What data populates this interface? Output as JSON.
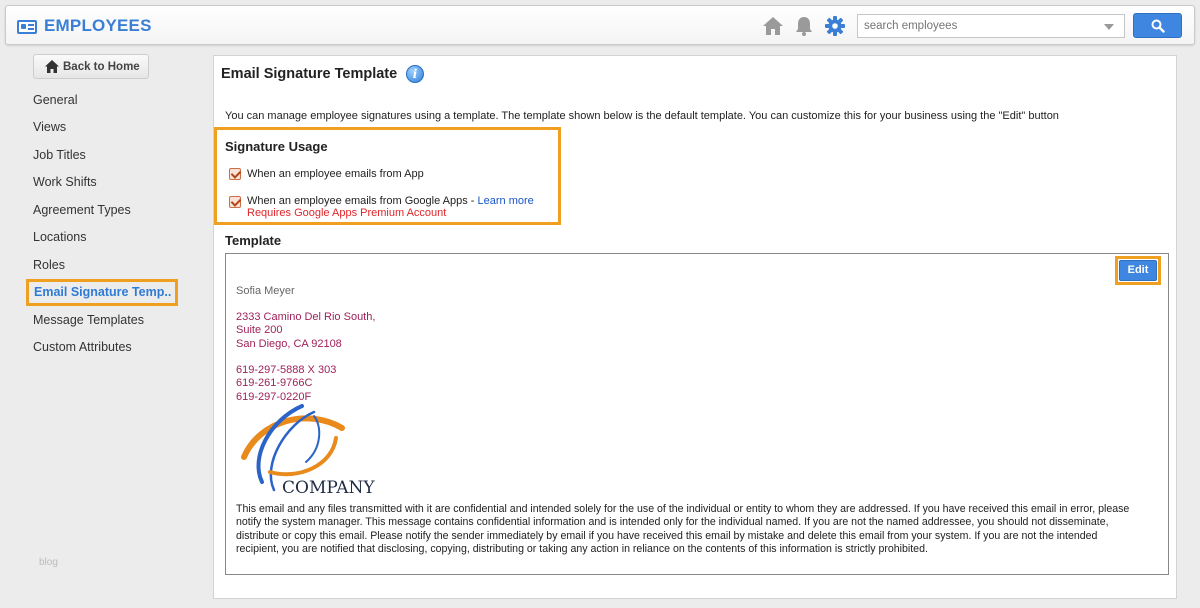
{
  "header": {
    "app_title": "EMPLOYEES",
    "search_placeholder": "search employees",
    "icons": [
      "home-icon",
      "bell-icon",
      "gear-icon",
      "search-icon"
    ],
    "accent_color": "#3a7fd5"
  },
  "sidebar": {
    "back_label": "Back to Home",
    "items": [
      {
        "label": "General"
      },
      {
        "label": "Views"
      },
      {
        "label": "Job Titles"
      },
      {
        "label": "Work Shifts"
      },
      {
        "label": "Agreement Types"
      },
      {
        "label": "Locations"
      },
      {
        "label": "Roles"
      },
      {
        "label": "Email Signature Temp..",
        "active": true
      },
      {
        "label": "Message Templates"
      },
      {
        "label": "Custom Attributes"
      }
    ],
    "footer": "blog"
  },
  "main": {
    "title": "Email Signature Template",
    "description": "You can manage employee signatures using a template. The template shown below is the default template. You can customize this for your business using the \"Edit\" button",
    "usage": {
      "title": "Signature Usage",
      "options": [
        {
          "label": "When an employee emails from App",
          "checked": true
        },
        {
          "label": "When an employee emails from Google Apps - ",
          "link": "Learn more",
          "checked": true,
          "note": "Requires Google Apps Premium Account"
        }
      ]
    },
    "template": {
      "title": "Template",
      "edit_label": "Edit",
      "name": "Sofia Meyer",
      "address": [
        "2333 Camino Del Rio South,",
        "Suite 200",
        "San Diego, CA 92108"
      ],
      "phones": [
        "619-297-5888 X 303",
        "619-261-9766C",
        "619-297-0220F"
      ],
      "logo_text": "COMPANY",
      "disclaimer": "This email and any files transmitted with it are confidential and intended solely for the use of the individual or entity to whom they are addressed. If you have received this email in error, please notify the system manager. This message contains confidential information and is intended only for the individual named. If you are not the named addressee, you should not disseminate, distribute or copy this email. Please notify the sender immediately by email if you have received this email by mistake and delete this email from your system. If you are not the intended recipient, you are notified that disclosing, copying, distributing or taking any action in reliance on the contents of this information is strictly prohibited."
    }
  }
}
